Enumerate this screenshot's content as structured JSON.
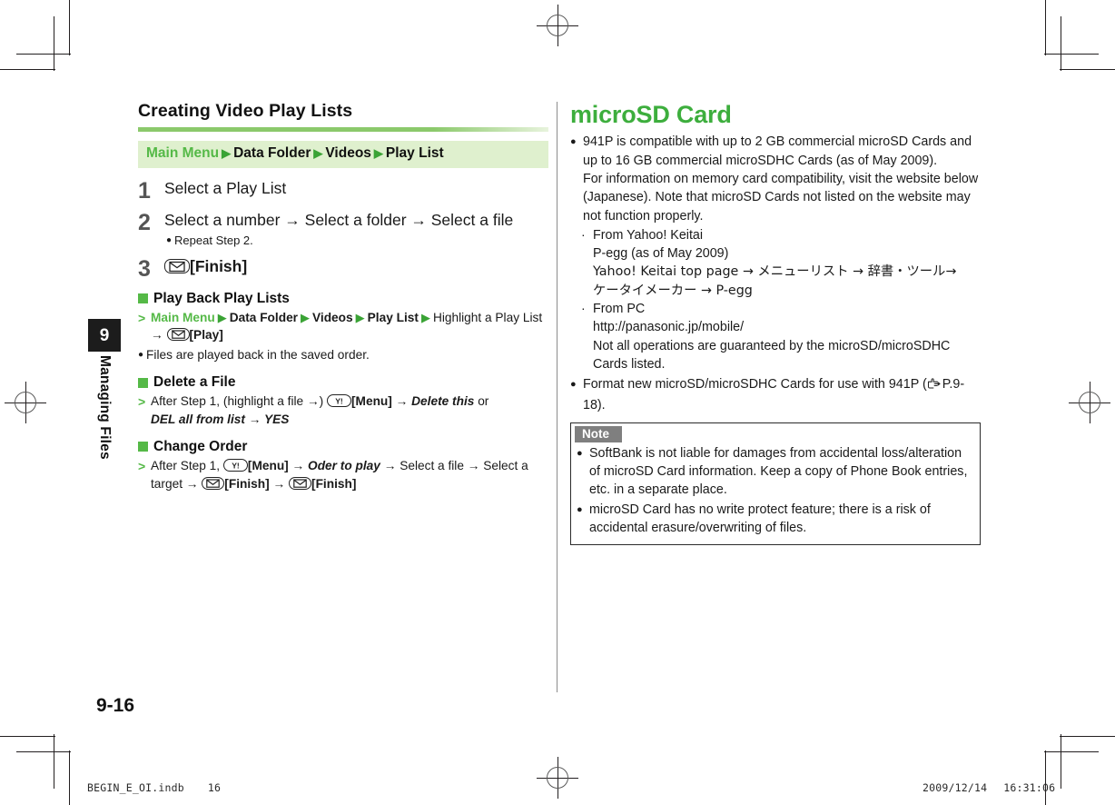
{
  "page": {
    "folio": "9-16",
    "chapter_number": "9",
    "chapter_title": "Managing Files",
    "imprint_file": "BEGIN_E_OI.indb",
    "imprint_page": "16",
    "timestamp_date": "2009/12/14",
    "timestamp_time": "16:31:06"
  },
  "colors": {
    "accent_green": "#55b947",
    "title_green": "#3dae3d",
    "path_bar_bg": "#dff0ce",
    "rule_green": "#8bc96b",
    "note_label_bg": "#7f7f7f",
    "step_number_gray": "#555555"
  },
  "left_column": {
    "section_title": "Creating Video Play Lists",
    "path_bar": {
      "start": "Main Menu",
      "segments": [
        "Data Folder",
        "Videos",
        "Play List"
      ]
    },
    "steps": [
      {
        "num": "1",
        "text": "Select a Play List",
        "sub": null
      },
      {
        "num": "2",
        "text": "Select a number → Select a folder → Select a file",
        "sub": "Repeat Step 2."
      },
      {
        "num": "3",
        "text": "[Finish]",
        "key_icon": "envelope-key-icon",
        "sub": null
      }
    ],
    "subsections": [
      {
        "heading": "Play Back Play Lists",
        "operation_parts": [
          {
            "type": "green-bold",
            "text": "Main Menu"
          },
          {
            "type": "tri"
          },
          {
            "type": "bold",
            "text": "Data Folder"
          },
          {
            "type": "tri"
          },
          {
            "type": "bold",
            "text": "Videos"
          },
          {
            "type": "tri"
          },
          {
            "type": "bold",
            "text": "Play List"
          },
          {
            "type": "tri"
          },
          {
            "type": "plain",
            "text": "Highlight a Play List → "
          },
          {
            "type": "key",
            "icon": "envelope-key-icon"
          },
          {
            "type": "bold",
            "text": "[Play]"
          }
        ],
        "notes": [
          "Files are played back in the saved order."
        ]
      },
      {
        "heading": "Delete a File",
        "operation_parts": [
          {
            "type": "plain",
            "text": "After Step 1, (highlight a file →) "
          },
          {
            "type": "key",
            "icon": "yahoo-key-icon"
          },
          {
            "type": "bold",
            "text": "[Menu]"
          },
          {
            "type": "plain",
            "text": " → "
          },
          {
            "type": "bold-italic",
            "text": "Delete this"
          },
          {
            "type": "plain",
            "text": " or "
          },
          {
            "type": "bold-italic",
            "text": "DEL all from list → YES"
          }
        ],
        "notes": []
      },
      {
        "heading": "Change Order",
        "operation_parts": [
          {
            "type": "plain",
            "text": "After Step 1, "
          },
          {
            "type": "key",
            "icon": "yahoo-key-icon"
          },
          {
            "type": "bold",
            "text": "[Menu]"
          },
          {
            "type": "plain",
            "text": " → "
          },
          {
            "type": "bold-italic",
            "text": "Oder to play"
          },
          {
            "type": "plain",
            "text": " → Select a file → Select a target → "
          },
          {
            "type": "key",
            "icon": "envelope-key-icon"
          },
          {
            "type": "bold",
            "text": "[Finish]"
          },
          {
            "type": "plain",
            "text": " → "
          },
          {
            "type": "key",
            "icon": "envelope-key-icon"
          },
          {
            "type": "bold",
            "text": "[Finish]"
          }
        ],
        "notes": []
      }
    ]
  },
  "right_column": {
    "title": "microSD Card",
    "bullets": [
      "941P is compatible with up to 2 GB commercial microSD Cards and up to 16 GB commercial microSDHC Cards (as of May 2009).\nFor information on memory card compatibility, visit the website below (Japanese). Note that microSD Cards not listed on the website may not function properly."
    ],
    "sub_items": [
      {
        "marker": "·",
        "lines": [
          "From Yahoo! Keitai",
          "P-egg (as of May 2009)",
          "Yahoo! Keitai top page → メニューリスト → 辞書・ツール→",
          "ケータイメーカー → P-egg"
        ]
      },
      {
        "marker": "·",
        "lines": [
          "From PC",
          "http://panasonic.jp/mobile/",
          "Not all operations are guaranteed by the microSD/microSDHC Cards listed."
        ]
      }
    ],
    "bullet_last_prefix": "Format new microSD/microSDHC Cards for use with 941P (",
    "bullet_last_ref": "P.9-18",
    "bullet_last_suffix": ").",
    "ref_icon": "pointing-hand-icon",
    "note_box": {
      "label": "Note",
      "items": [
        "SoftBank is not liable for damages from accidental loss/alteration of microSD Card information. Keep a copy of Phone Book entries, etc. in a separate place.",
        "microSD Card has no write protect feature; there is a risk of accidental erasure/overwriting of files."
      ]
    }
  }
}
